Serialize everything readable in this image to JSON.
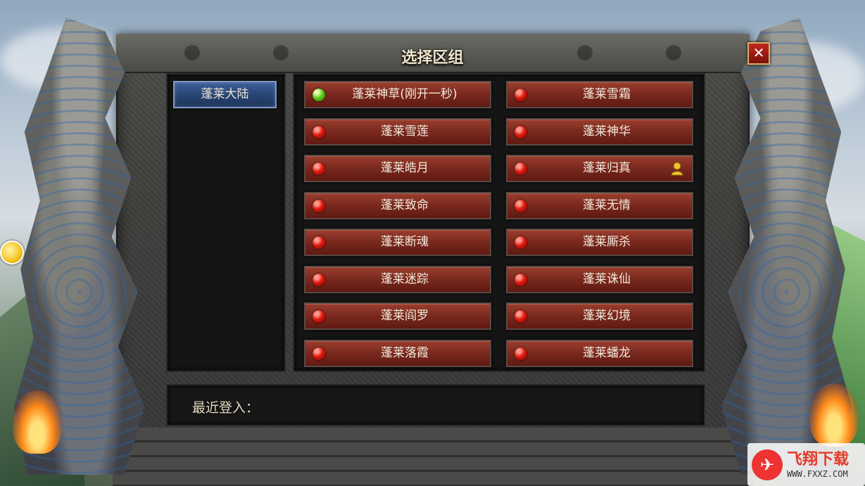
{
  "dialog": {
    "title": "选择区组",
    "close_label": "✕"
  },
  "regions": [
    {
      "label": "蓬莱大陆",
      "selected": true
    }
  ],
  "servers": [
    {
      "label": "蓬莱神草(刚开一秒)",
      "status": "green"
    },
    {
      "label": "蓬莱雪霜",
      "status": "red"
    },
    {
      "label": "蓬莱雪莲",
      "status": "red"
    },
    {
      "label": "蓬莱神华",
      "status": "red"
    },
    {
      "label": "蓬莱皓月",
      "status": "red"
    },
    {
      "label": "蓬莱归真",
      "status": "red",
      "has_character": true
    },
    {
      "label": "蓬莱致命",
      "status": "red"
    },
    {
      "label": "蓬莱无情",
      "status": "red"
    },
    {
      "label": "蓬莱断魂",
      "status": "red"
    },
    {
      "label": "蓬莱厮杀",
      "status": "red"
    },
    {
      "label": "蓬莱迷踪",
      "status": "red"
    },
    {
      "label": "蓬莱诛仙",
      "status": "red"
    },
    {
      "label": "蓬莱阎罗",
      "status": "red"
    },
    {
      "label": "蓬莱幻境",
      "status": "red"
    },
    {
      "label": "蓬莱落霞",
      "status": "red"
    },
    {
      "label": "蓬莱蟠龙",
      "status": "red"
    }
  ],
  "recent": {
    "label": "最近登入："
  },
  "watermark": {
    "name": "飞翔下载",
    "url": "WWW.FXXZ.COM"
  },
  "colors": {
    "server_button": "#7c2a1f",
    "region_tab": "#2a4676",
    "status_online": "#5fd11e",
    "status_busy": "#e01a10"
  }
}
